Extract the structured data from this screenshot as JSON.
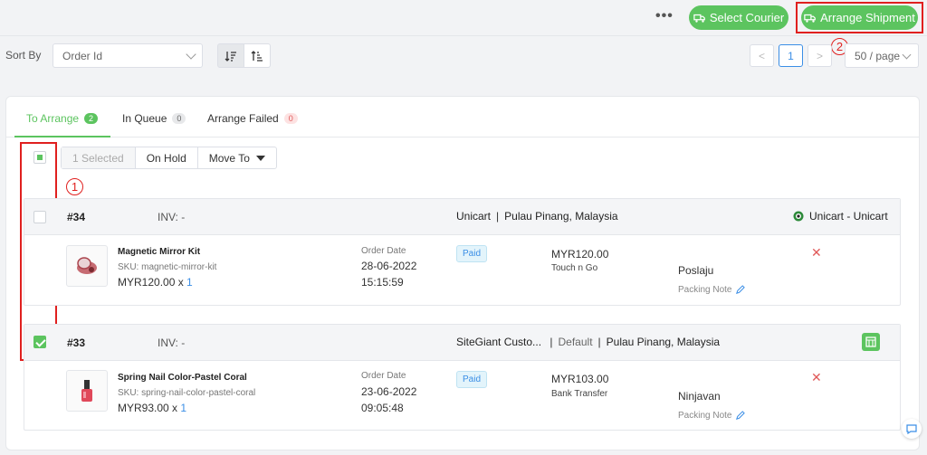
{
  "header": {
    "more_label": "•••",
    "select_courier_label": "Select Courier",
    "arrange_shipment_label": "Arrange Shipment",
    "annotation_2": "2"
  },
  "sort": {
    "label": "Sort By",
    "field_value": "Order Id",
    "descending_icon": "sort-descending-icon",
    "ascending_icon": "sort-ascending-icon"
  },
  "pagination": {
    "prev": "<",
    "current_page": "1",
    "next": ">",
    "per_page": "50 / page"
  },
  "tabs": [
    {
      "label": "To Arrange",
      "count": "2"
    },
    {
      "label": "In Queue",
      "count": "0"
    },
    {
      "label": "Arrange Failed",
      "count": "0"
    }
  ],
  "bulk": {
    "selected_label": "1 Selected",
    "on_hold_label": "On Hold",
    "move_to_label": "Move To",
    "annotation_1": "1"
  },
  "orders": [
    {
      "id": "#34",
      "inv": "INV: -",
      "channel": "Unicart",
      "location": "Pulau Pinang, Malaysia",
      "right_channel": "Unicart - Unicart",
      "checked": false,
      "product_name": "Magnetic Mirror Kit",
      "sku": "SKU: magnetic-mirror-kit",
      "price": "MYR120.00 x ",
      "qty": "1",
      "order_date_label": "Order Date",
      "order_date": "28-06-2022",
      "order_time": "15:15:59",
      "status": "Paid",
      "amount": "MYR120.00",
      "payment": "Touch n Go",
      "courier": "Poslaju",
      "packing_note": "Packing Note",
      "remove": "✕"
    },
    {
      "id": "#33",
      "inv": "INV: -",
      "channel": "SiteGiant Custo...",
      "channel_default": "Default",
      "location": "Pulau Pinang, Malaysia",
      "checked": true,
      "product_name": "Spring Nail Color-Pastel Coral",
      "sku": "SKU: spring-nail-color-pastel-coral",
      "price": "MYR93.00 x ",
      "qty": "1",
      "order_date_label": "Order Date",
      "order_date": "23-06-2022",
      "order_time": "09:05:48",
      "status": "Paid",
      "amount": "MYR103.00",
      "payment": "Bank Transfer",
      "courier": "Ninjavan",
      "packing_note": "Packing Note",
      "remove": "✕"
    }
  ],
  "colors": {
    "accent_green": "#5cc45f",
    "annotation_red": "#e0201f",
    "link_blue": "#3a8ee6",
    "remove_red": "#e05a5a"
  }
}
